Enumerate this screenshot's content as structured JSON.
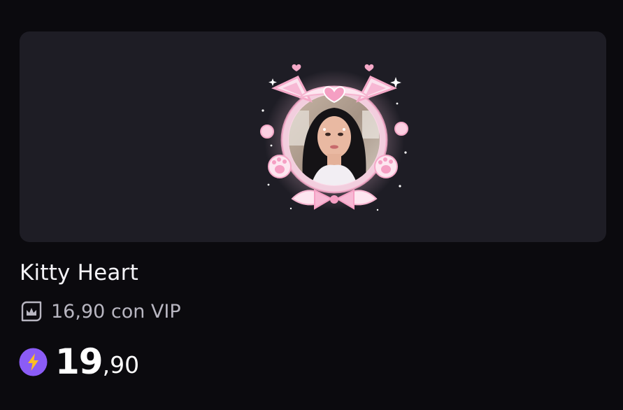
{
  "product": {
    "title": "Kitty Heart",
    "preview_icon": "avatar-frame-pink-kitty",
    "vip_price": "16,90 con VIP",
    "vip_icon": "crown-icon",
    "price_integer": "19",
    "price_decimal": ",90",
    "currency_icon": "lightning-bolt-icon"
  },
  "colors": {
    "background": "#0b0a0e",
    "card": "#1e1d25",
    "accent": "#8b5cf6",
    "frame_pink": "#f7b8d4"
  }
}
